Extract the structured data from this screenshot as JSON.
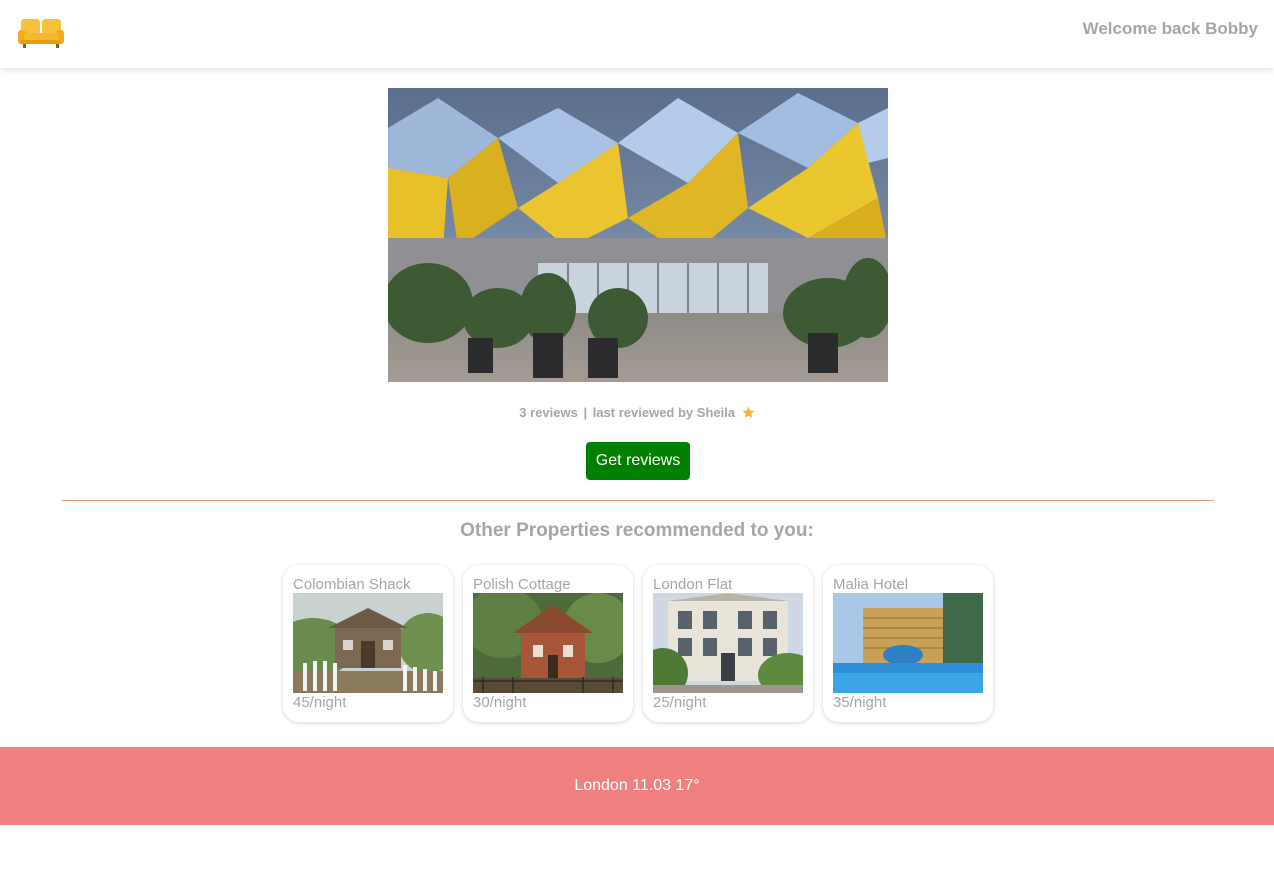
{
  "header": {
    "logo_icon": "sofa-icon",
    "welcome_text": "Welcome back Bobby"
  },
  "hero": {
    "image": "cube-houses-photo"
  },
  "reviews": {
    "count_text": "3 reviews",
    "separator": "|",
    "last_reviewed_text": "last reviewed by Sheila",
    "icon": "star-icon",
    "button_label": "Get reviews"
  },
  "recommendations": {
    "title": "Other Properties recommended to you:",
    "items": [
      {
        "name": "Colombian Shack",
        "price": "45/night",
        "image": "wooden-shack-photo"
      },
      {
        "name": "Polish Cottage",
        "price": "30/night",
        "image": "brick-cottage-photo"
      },
      {
        "name": "London Flat",
        "price": "25/night",
        "image": "townhouse-photo"
      },
      {
        "name": "Malia Hotel",
        "price": "35/night",
        "image": "hotel-pool-photo"
      }
    ]
  },
  "footer": {
    "weather_text": "London 11.03 17°"
  },
  "colors": {
    "accent_button": "#008000",
    "footer_bg": "#f08080",
    "divider": "#e8957a",
    "muted_text": "#a6a6a6",
    "logo": "#f5b82e"
  }
}
